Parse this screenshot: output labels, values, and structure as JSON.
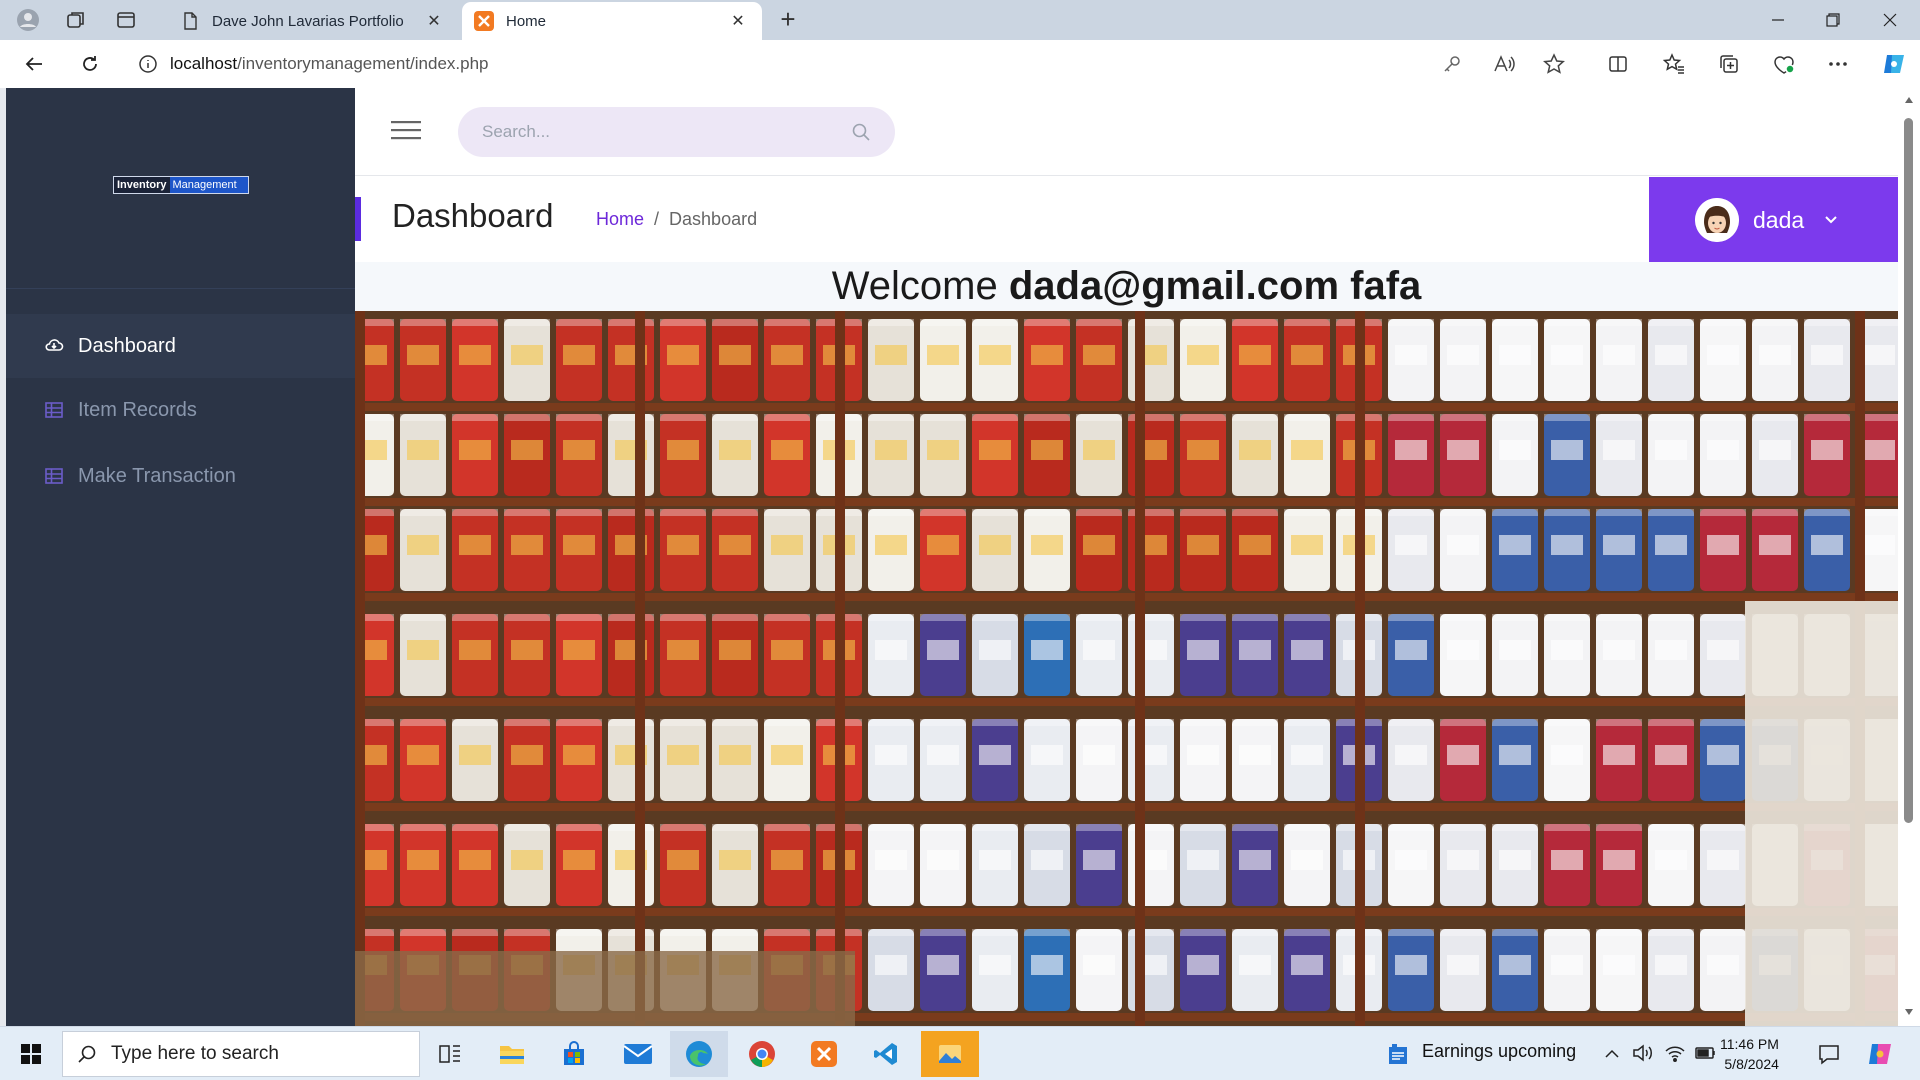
{
  "browser": {
    "tabs": [
      {
        "title": "Dave John Lavarias Portfolio",
        "close": "✕"
      },
      {
        "title": "Home",
        "close": "✕"
      }
    ],
    "new_tab": "+",
    "url_host": "localhost",
    "url_path": "/inventorymanagement/index.php"
  },
  "app": {
    "logo_left": "Inventory",
    "logo_right": "Management",
    "search_placeholder": "Search...",
    "nav": [
      {
        "label": "Dashboard",
        "icon": "cloud-icon",
        "active": true
      },
      {
        "label": "Item Records",
        "icon": "table-icon",
        "active": false
      },
      {
        "label": "Make Transaction",
        "icon": "table-icon",
        "active": false
      }
    ],
    "page_title": "Dashboard",
    "breadcrumb": {
      "home": "Home",
      "sep": "/",
      "current": "Dashboard"
    },
    "user": {
      "name": "dada"
    },
    "welcome_prefix": "Welcome",
    "welcome_name": "dada@gmail.com fafa",
    "colors": {
      "sidebar": "#2b3446",
      "accent": "#7c3aed",
      "search_bg": "#ede7f6"
    }
  },
  "taskbar": {
    "search_placeholder": "Type here to search",
    "widget": "Earnings upcoming",
    "time": "11:46 PM",
    "date": "5/8/2024"
  }
}
